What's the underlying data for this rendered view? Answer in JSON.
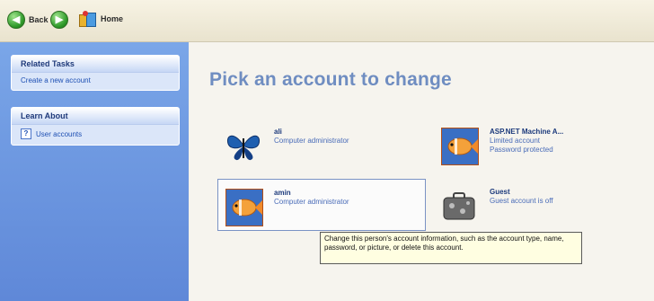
{
  "toolbar": {
    "back_label": "Back",
    "home_label": "Home"
  },
  "sidebar": {
    "related_tasks": {
      "title": "Related Tasks",
      "items": [
        "Create a new account"
      ]
    },
    "learn_about": {
      "title": "Learn About",
      "items": [
        "User accounts"
      ]
    }
  },
  "main": {
    "title": "Pick an account to change",
    "accounts": [
      {
        "name": "ali",
        "lines": [
          "Computer administrator"
        ],
        "icon": "butterfly-icon"
      },
      {
        "name": "ASP.NET Machine A...",
        "lines": [
          "Limited account",
          "Password protected"
        ],
        "icon": "fish-icon"
      },
      {
        "name": "amin",
        "lines": [
          "Computer administrator"
        ],
        "icon": "fish-icon",
        "selected": true
      },
      {
        "name": "Guest",
        "lines": [
          "Guest account is off"
        ],
        "icon": "briefcase-icon"
      }
    ]
  },
  "tooltip": {
    "text": "Change this person's account information, such as the account type, name, password, or picture, or delete this account."
  },
  "colors": {
    "sidebar_bg": "#6b95dc",
    "title_color": "#6f8dc1",
    "link_color": "#1d4fb3"
  }
}
